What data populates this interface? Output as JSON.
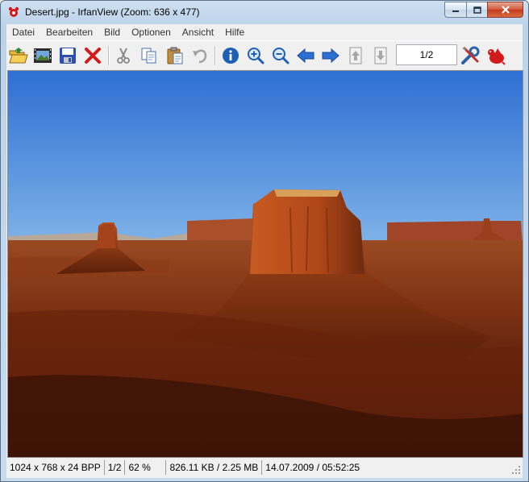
{
  "window": {
    "title": "Desert.jpg - IrfanView (Zoom: 636 x 477)"
  },
  "menu": [
    "Datei",
    "Bearbeiten",
    "Bild",
    "Optionen",
    "Ansicht",
    "Hilfe"
  ],
  "toolbar": {
    "page_field": "1/2",
    "icons": [
      "open-folder-icon",
      "slideshow-icon",
      "save-icon",
      "delete-icon",
      "cut-icon",
      "copy-icon",
      "paste-icon",
      "undo-icon",
      "info-icon",
      "zoom-in-icon",
      "zoom-out-icon",
      "previous-arrow-icon",
      "next-arrow-icon",
      "previous-page-icon",
      "next-page-icon",
      "settings-icon",
      "irfanview-logo-icon"
    ]
  },
  "status": {
    "dimensions": "1024 x 768 x 24 BPP",
    "page": "1/2",
    "zoom": "62 %",
    "size": "826.11 KB / 2.25 MB",
    "datetime": "14.07.2009 / 05:52:25"
  },
  "colors": {
    "title_bar": "#c8dbee",
    "close_button": "#c9452a",
    "accent": "#1f5fb4"
  }
}
